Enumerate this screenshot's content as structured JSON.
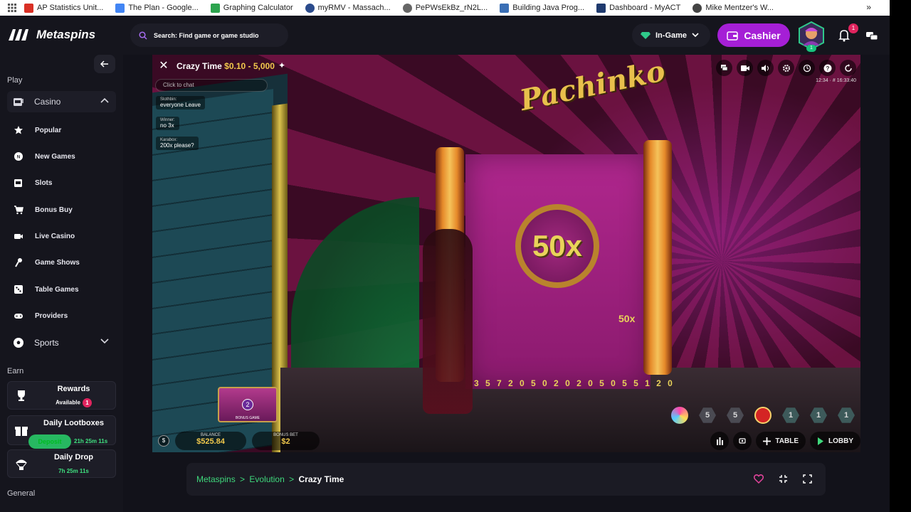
{
  "bookmarks": [
    {
      "label": "AP Statistics Unit...",
      "color": "#d93025"
    },
    {
      "label": "The Plan - Google...",
      "color": "#4285f4"
    },
    {
      "label": "Graphing Calculator",
      "color": "#2da44e"
    },
    {
      "label": "myRMV - Massach...",
      "color": "#2b4b8c"
    },
    {
      "label": "PePWsEkBz_rN2L...",
      "color": "#666666"
    },
    {
      "label": "Building Java Prog...",
      "color": "#3a6fb5"
    },
    {
      "label": "Dashboard - MyACT",
      "color": "#1f3a6e"
    },
    {
      "label": "Mike Mentzer's W...",
      "color": "#444444"
    }
  ],
  "topbar": {
    "logo": "Metaspins",
    "search_placeholder": "Search: Find game or game studio",
    "mode": "In-Game",
    "cashier": "Cashier",
    "avatar_level": "1",
    "notifications": "1"
  },
  "sidebar": {
    "play_label": "Play",
    "casino": "Casino",
    "items": [
      {
        "label": "Popular",
        "icon": "star-icon"
      },
      {
        "label": "New Games",
        "icon": "new-badge-icon"
      },
      {
        "label": "Slots",
        "icon": "slot-machine-icon"
      },
      {
        "label": "Bonus Buy",
        "icon": "cart-icon"
      },
      {
        "label": "Live Casino",
        "icon": "camera-icon"
      },
      {
        "label": "Game Shows",
        "icon": "microphone-icon"
      },
      {
        "label": "Table Games",
        "icon": "dice-icon"
      },
      {
        "label": "Providers",
        "icon": "gamepad-icon"
      }
    ],
    "sports": "Sports",
    "earn_label": "Earn",
    "rewards": {
      "title": "Rewards",
      "sub": "Available",
      "count": "1"
    },
    "lootboxes": {
      "title": "Daily Lootboxes",
      "deposit": "Deposit",
      "timer": "21h 25m 11s"
    },
    "drop": {
      "title": "Daily Drop",
      "timer": "7h 25m 11s"
    },
    "general_label": "General"
  },
  "game": {
    "title": "Crazy Time",
    "limits": "$0.10 - 5,000",
    "chat_placeholder": "Click to chat",
    "chat": [
      {
        "user": "Slothbin:",
        "text": "everyone Leave"
      },
      {
        "user": "Winner:",
        "text": "no 3x"
      },
      {
        "user": "Karabox:",
        "text": "200x please?"
      }
    ],
    "time": "12:34 · # 16:33:40",
    "logo_text": "Pachinko",
    "multiplier": "50x",
    "small_multiplier": "50x",
    "pockets": "3 5 7 2 0 5 0 2 0 2 0 5 0 5 5 1 2 0",
    "bonus_thumb": {
      "number": "2",
      "caption": "BONUS GAME"
    },
    "balance_label": "BALANCE",
    "balance_value": "$525.84",
    "bet_label": "BONUS BET",
    "bet_value": "$2",
    "history": [
      "5",
      "5",
      "1",
      "1",
      "1"
    ],
    "table_label": "TABLE",
    "lobby_label": "LOBBY"
  },
  "breadcrumb": {
    "items": [
      "Metaspins",
      "Evolution"
    ],
    "separator": ">",
    "current": "Crazy Time"
  },
  "colors": {
    "accent": "#a51fd6",
    "green": "#3fd87c",
    "gold": "#f2c94c"
  }
}
